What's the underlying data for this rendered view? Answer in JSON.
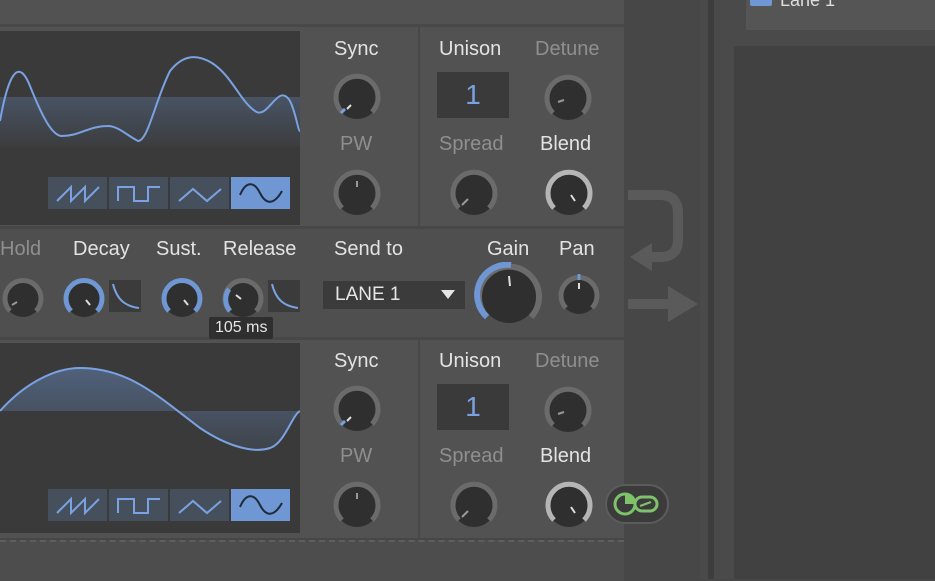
{
  "colors": {
    "accent": "#6e97d4",
    "link_green": "#7ec26a",
    "panel": "#525252",
    "background": "#474747"
  },
  "right_panel": {
    "lane_label": "Lane 1"
  },
  "osc1": {
    "sync_label": "Sync",
    "pw_label": "PW",
    "unison_label": "Unison",
    "unison_value": "1",
    "detune_label": "Detune",
    "spread_label": "Spread",
    "blend_label": "Blend",
    "waveforms": [
      "saw-wave-icon",
      "square-wave-icon",
      "triangle-wave-icon",
      "sine-wave-icon"
    ],
    "selected_waveform": "sine-wave-icon"
  },
  "envelope": {
    "hold_label": "Hold",
    "decay_label": "Decay",
    "sustain_label": "Sust.",
    "release_label": "Release",
    "release_tooltip": "105 ms",
    "send_to_label": "Send to",
    "send_to_value": "LANE 1",
    "gain_label": "Gain",
    "pan_label": "Pan"
  },
  "osc2": {
    "sync_label": "Sync",
    "pw_label": "PW",
    "unison_label": "Unison",
    "unison_value": "1",
    "detune_label": "Detune",
    "spread_label": "Spread",
    "blend_label": "Blend",
    "waveforms": [
      "saw-wave-icon",
      "square-wave-icon",
      "triangle-wave-icon",
      "sine-wave-icon"
    ],
    "selected_waveform": "sine-wave-icon"
  },
  "icons": {
    "link": "link-toggle-icon",
    "return_arrow": "return-arrow-icon",
    "output_arrow": "output-arrow-icon"
  }
}
